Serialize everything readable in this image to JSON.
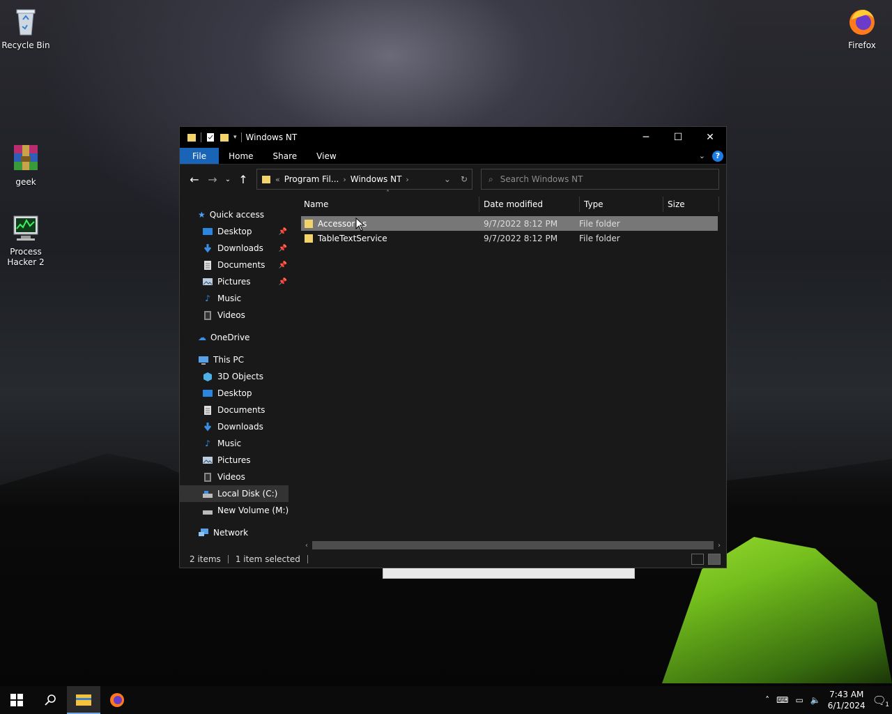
{
  "desktop": {
    "icons": [
      {
        "label": "Recycle Bin"
      },
      {
        "label": "geek"
      },
      {
        "label": "Process Hacker 2"
      },
      {
        "label": "Firefox"
      }
    ]
  },
  "window": {
    "title": "Windows NT",
    "ribbon": {
      "tabs": [
        "File",
        "Home",
        "Share",
        "View"
      ],
      "help": "?"
    },
    "address": {
      "overflow": "«",
      "crumbs": [
        "Program Fil...",
        "Windows NT"
      ]
    },
    "search": {
      "placeholder": "Search Windows NT"
    },
    "sidebar": {
      "quick_access": "Quick access",
      "quick_items": [
        "Desktop",
        "Downloads",
        "Documents",
        "Pictures",
        "Music",
        "Videos"
      ],
      "onedrive": "OneDrive",
      "this_pc": "This PC",
      "pc_items": [
        "3D Objects",
        "Desktop",
        "Documents",
        "Downloads",
        "Music",
        "Pictures",
        "Videos",
        "Local Disk (C:)",
        "New Volume (M:)"
      ],
      "network": "Network"
    },
    "columns": {
      "name": "Name",
      "date": "Date modified",
      "type": "Type",
      "size": "Size"
    },
    "files": [
      {
        "name": "Accessories",
        "date": "9/7/2022 8:12 PM",
        "type": "File folder",
        "selected": true
      },
      {
        "name": "TableTextService",
        "date": "9/7/2022 8:12 PM",
        "type": "File folder",
        "selected": false
      }
    ],
    "status": {
      "items": "2 items",
      "selected": "1 item selected"
    }
  },
  "taskbar": {
    "clock": {
      "time": "7:43 AM",
      "date": "6/1/2024"
    },
    "notifications": "1"
  },
  "colors": {
    "ribbon_file": "#1a64b8",
    "selection": "#777777",
    "folder": "#f3d36b"
  }
}
